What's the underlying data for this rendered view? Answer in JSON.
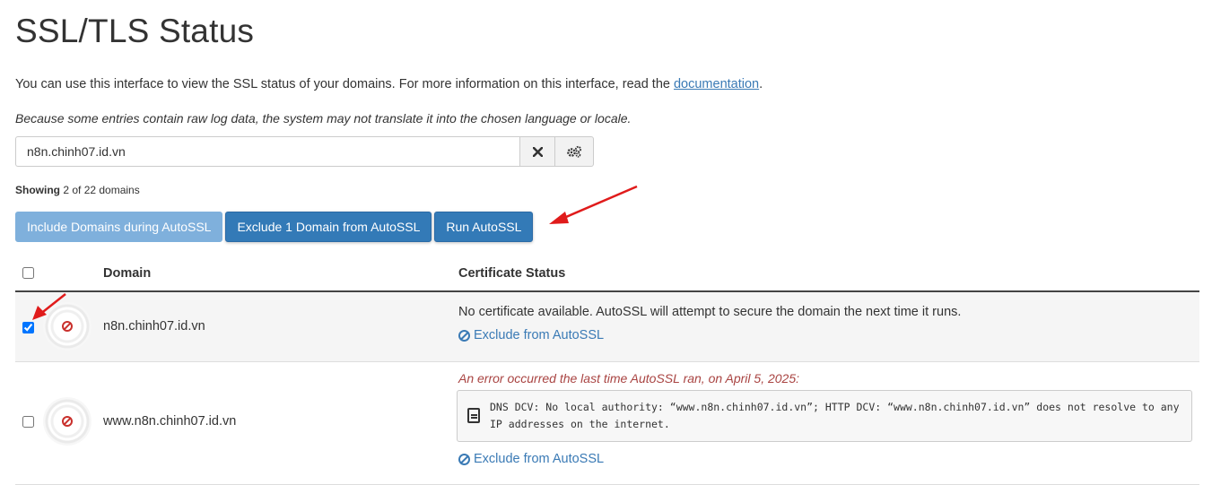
{
  "header": {
    "title": "SSL/TLS Status"
  },
  "intro": {
    "text": "You can use this interface to view the SSL status of your domains. For more information on this interface, read the ",
    "link": "documentation",
    "suffix": "."
  },
  "note": "Because some entries contain raw log data, the system may not translate it into the chosen language or locale.",
  "search": {
    "value": "n8n.chinh07.id.vn",
    "clear_icon": "times-icon",
    "settings_icon": "gears-icon"
  },
  "showing": {
    "label": "Showing",
    "text": "2 of 22 domains"
  },
  "actions": {
    "include_label": "Include Domains during AutoSSL",
    "exclude_label": "Exclude 1 Domain from AutoSSL",
    "run_label": "Run AutoSSL"
  },
  "table": {
    "headers": {
      "domain": "Domain",
      "status": "Certificate Status"
    },
    "rows": [
      {
        "checked": true,
        "domain": "n8n.chinh07.id.vn",
        "status": "No certificate available. AutoSSL will attempt to secure the domain the next time it runs.",
        "exclude_label": "Exclude from AutoSSL"
      },
      {
        "checked": false,
        "domain": "www.n8n.chinh07.id.vn",
        "error": "An error occurred the last time AutoSSL ran, on April 5, 2025:",
        "log": "DNS DCV: No local authority: “www.n8n.chinh07.id.vn”; HTTP DCV: “www.n8n.chinh07.id.vn” does not resolve to any IP addresses on the internet.",
        "exclude_label": "Exclude from AutoSSL"
      }
    ]
  },
  "colors": {
    "primary": "#337ab7",
    "primary_disabled": "#7fb0dc",
    "link": "#3a7ab5",
    "error": "#a94442",
    "annotation_arrow": "#e01b1b"
  }
}
